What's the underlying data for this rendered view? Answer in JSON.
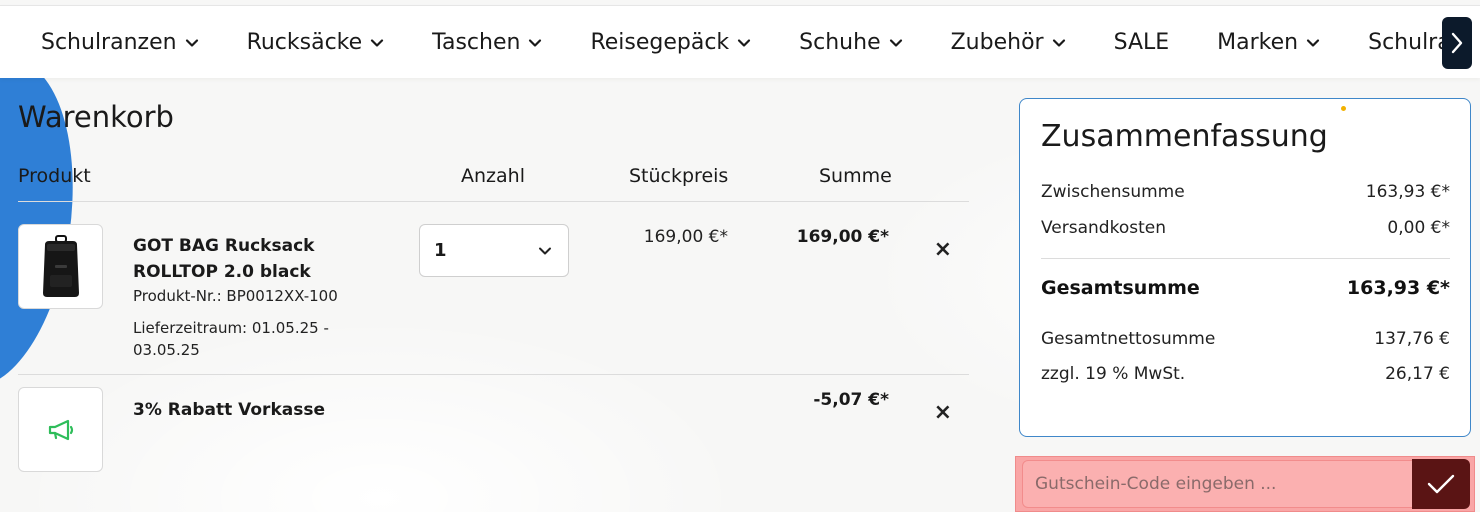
{
  "nav": {
    "items": [
      {
        "label": "Schulranzen",
        "has_dropdown": true
      },
      {
        "label": "Rucksäcke",
        "has_dropdown": true
      },
      {
        "label": "Taschen",
        "has_dropdown": true
      },
      {
        "label": "Reisegepäck",
        "has_dropdown": true
      },
      {
        "label": "Schuhe",
        "has_dropdown": true
      },
      {
        "label": "Zubehör",
        "has_dropdown": true
      },
      {
        "label": "SALE",
        "has_dropdown": false
      },
      {
        "label": "Marken",
        "has_dropdown": true
      },
      {
        "label": "Schulra",
        "has_dropdown": false
      }
    ],
    "next_icon": "chevron-right-icon"
  },
  "cart": {
    "title": "Warenkorb",
    "headers": {
      "product": "Produkt",
      "quantity": "Anzahl",
      "unit_price": "Stückpreis",
      "sum": "Summe"
    },
    "items": [
      {
        "name": "GOT BAG Rucksack ROLLTOP 2.0 black",
        "product_no": "Produkt-Nr.: BP0012XX-100",
        "delivery": "Lieferzeitraum: 01.05.25 - 03.05.25",
        "quantity": "1",
        "unit_price": "169,00 €*",
        "sum": "169,00 €*",
        "icon": "backpack-image"
      },
      {
        "name": "3% Rabatt Vorkasse",
        "sum": "-5,07 €*",
        "icon": "megaphone-icon"
      }
    ],
    "remove_glyph": "×"
  },
  "summary": {
    "title": "Zusammenfassung",
    "subtotal_label": "Zwischensumme",
    "subtotal_value": "163,93 €*",
    "shipping_label": "Versandkosten",
    "shipping_value": "0,00 €*",
    "total_label": "Gesamtsumme",
    "total_value": "163,93 €*",
    "net_label": "Gesamtnettosumme",
    "net_value": "137,76 €",
    "vat_label": "zzgl. 19 % MwSt.",
    "vat_value": "26,17 €"
  },
  "coupon": {
    "placeholder": "Gutschein-Code eingeben ...",
    "submit_icon": "checkmark-icon"
  },
  "colors": {
    "accent_blue": "#3f87c9",
    "coupon_bg": "#f9a6a6",
    "coupon_button": "#5a1414",
    "nav_next_bg": "#0c1a2b",
    "megaphone_green": "#2ebd5a"
  }
}
